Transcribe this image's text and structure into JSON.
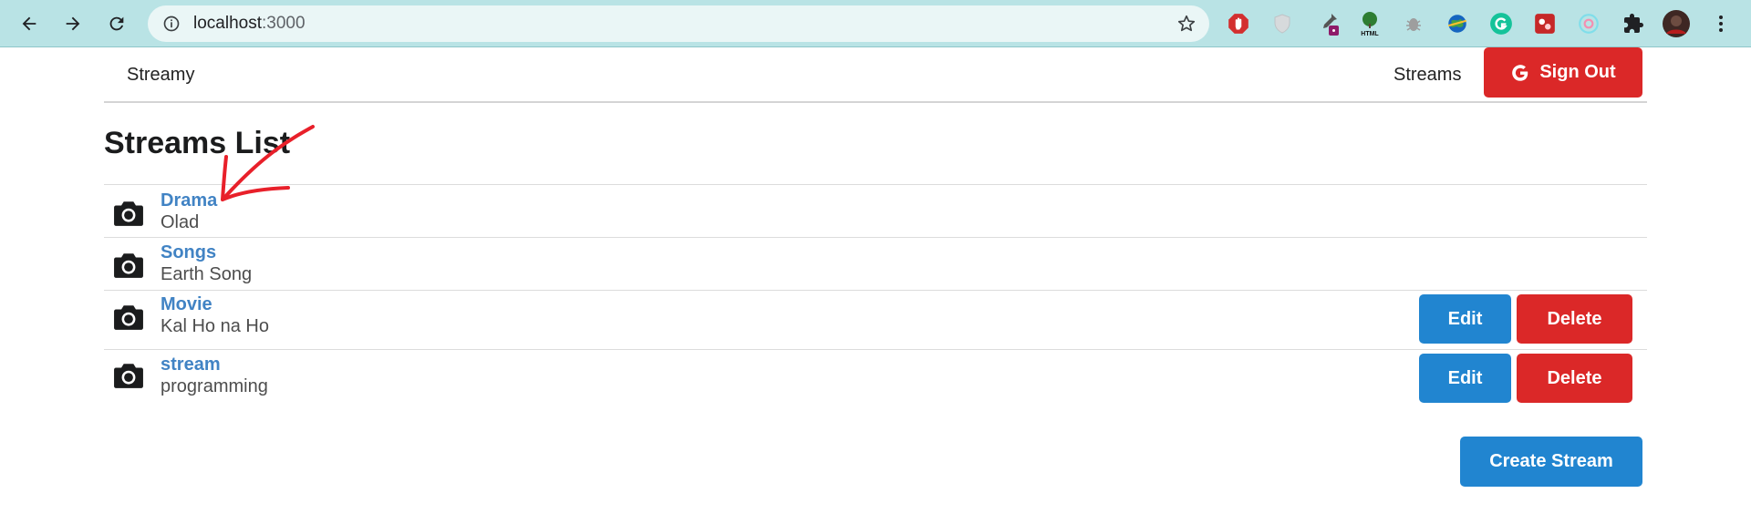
{
  "browser": {
    "url_host": "localhost",
    "url_rest": ":3000",
    "extensions": [
      "adblock-icon",
      "shield-icon",
      "eyedropper-icon",
      "html-tree-icon",
      "bug-icon",
      "globe-icon",
      "grammarly-icon",
      "puzzle-red-icon",
      "spiral-icon",
      "extensions-puzzle-icon",
      "profile-avatar",
      "menu-dots-icon"
    ],
    "extension_label_html": "HTML"
  },
  "nav": {
    "brand": "Streamy",
    "streams_link": "Streams",
    "sign_out": "Sign Out"
  },
  "page_title": "Streams List",
  "streams": [
    {
      "title": "Drama",
      "description": "Olad",
      "owned": false
    },
    {
      "title": "Songs",
      "description": "Earth Song",
      "owned": false
    },
    {
      "title": "Movie",
      "description": "Kal Ho na Ho",
      "owned": true
    },
    {
      "title": "stream",
      "description": "programming",
      "owned": true
    }
  ],
  "buttons": {
    "edit": "Edit",
    "delete": "Delete",
    "create": "Create Stream"
  },
  "colors": {
    "chrome_bg": "#b9e3e5",
    "primary_blue": "#2185d0",
    "danger_red": "#db2828",
    "link_blue": "#4183c4",
    "annotation_red": "#e8202a"
  }
}
